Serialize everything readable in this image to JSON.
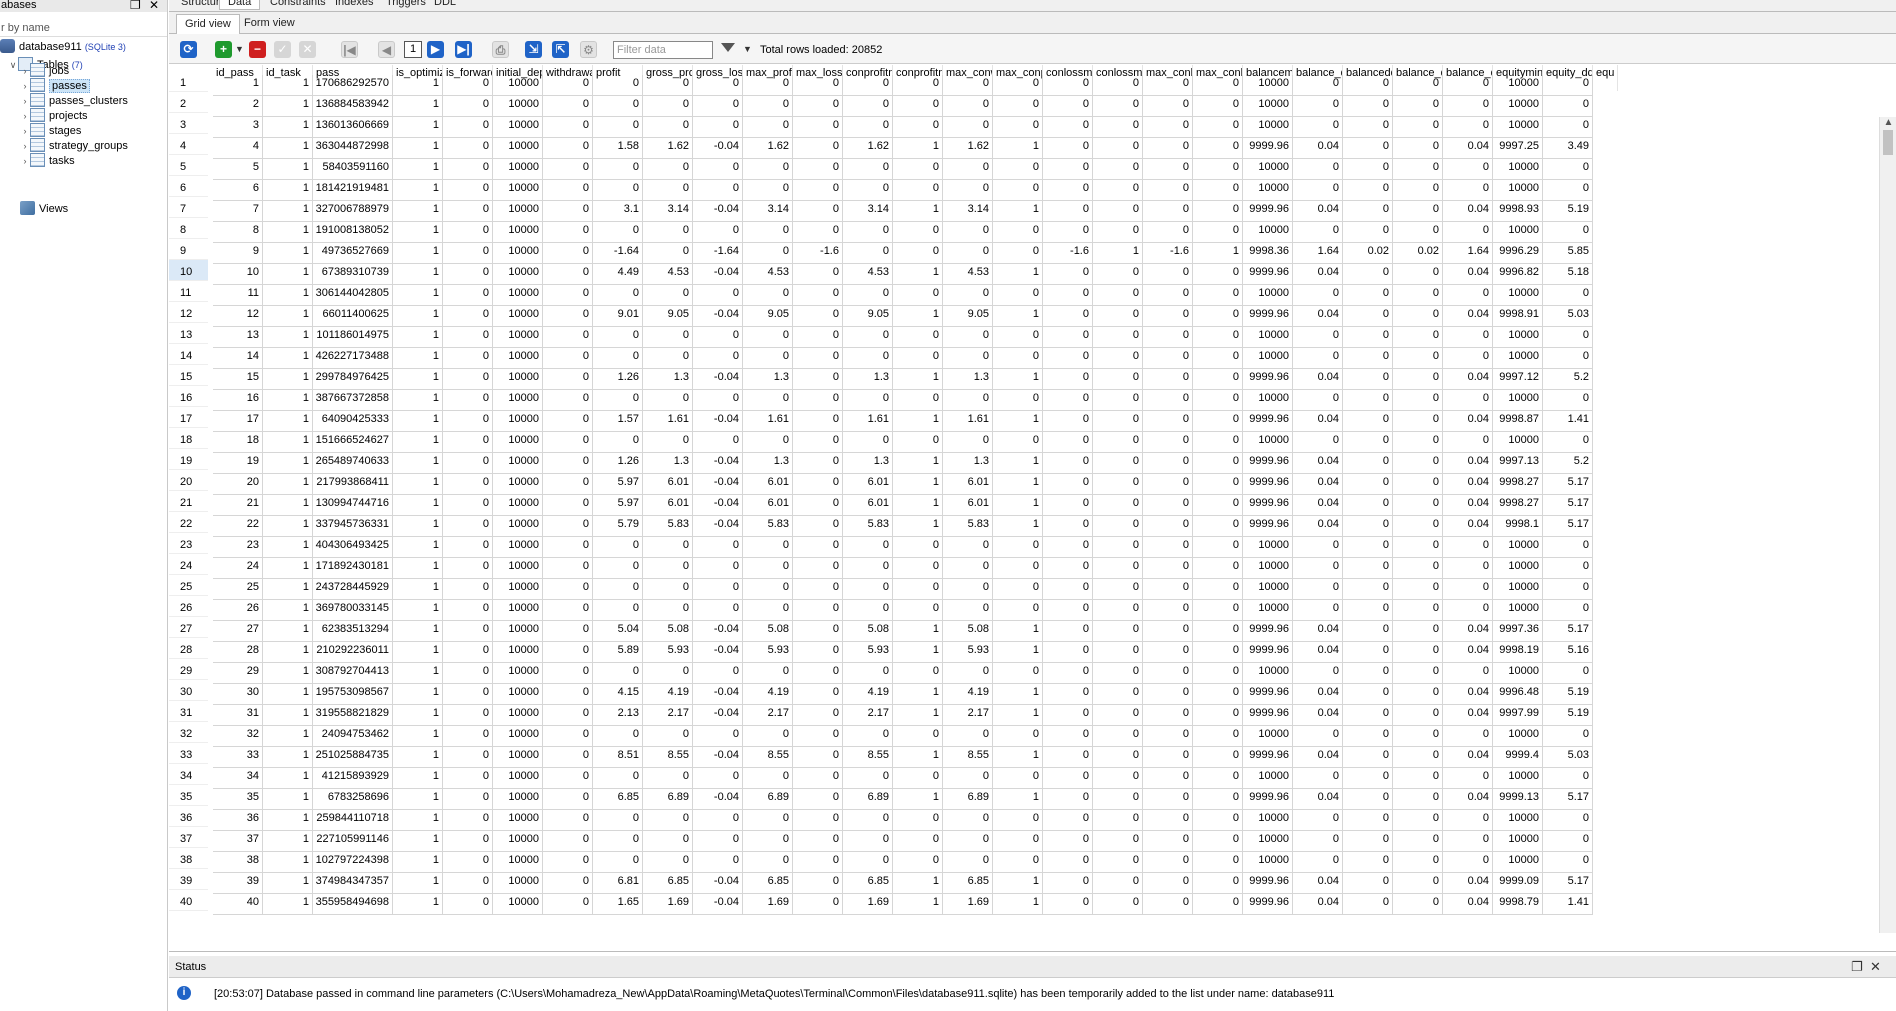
{
  "left_panel": {
    "title": "abases",
    "filter_placeholder": "r by name",
    "database": {
      "name": "database911",
      "type": "(SQLite 3)"
    },
    "tables": {
      "label": "Tables",
      "count": "(7)",
      "items": [
        "jobs",
        "passes",
        "passes_clusters",
        "projects",
        "stages",
        "strategy_groups",
        "tasks"
      ],
      "selected": "passes"
    },
    "views_label": "Views"
  },
  "top_tabs": [
    "Structure",
    "Data",
    "Constraints",
    "Indexes",
    "Triggers",
    "DDL"
  ],
  "active_top_tab": "Data",
  "sub_tabs": [
    "Grid view",
    "Form view"
  ],
  "active_sub_tab": "Grid view",
  "toolbar": {
    "page": "1",
    "filter_placeholder": "Filter data",
    "total_rows": "Total rows loaded: 20852"
  },
  "grid": {
    "columns": [
      "id_pass",
      "id_task",
      "pass",
      "is_optimiza",
      "is_forward",
      "initial_depc",
      "withdrawal",
      "profit",
      "gross_prof",
      "gross_loss",
      "max_profit",
      "max_lossti",
      "conprofitm",
      "conprofitm",
      "max_conwi",
      "max_conpr",
      "conlossmax",
      "conlossmax",
      "max_conlos",
      "max_conlos",
      "balancemin",
      "balance_dc",
      "balancedd_",
      "balance_dc",
      "balance_dc",
      "equitymin",
      "equity_dd",
      "equ"
    ],
    "current_row": 10,
    "rows": [
      [
        "1",
        "1",
        "170686292570",
        "1",
        "0",
        "10000",
        "0",
        "0",
        "0",
        "0",
        "0",
        "0",
        "0",
        "0",
        "0",
        "0",
        "0",
        "0",
        "0",
        "0",
        "10000",
        "0",
        "0",
        "0",
        "0",
        "10000",
        "0"
      ],
      [
        "2",
        "1",
        "136884583942",
        "1",
        "0",
        "10000",
        "0",
        "0",
        "0",
        "0",
        "0",
        "0",
        "0",
        "0",
        "0",
        "0",
        "0",
        "0",
        "0",
        "0",
        "10000",
        "0",
        "0",
        "0",
        "0",
        "10000",
        "0"
      ],
      [
        "3",
        "1",
        "136013606669",
        "1",
        "0",
        "10000",
        "0",
        "0",
        "0",
        "0",
        "0",
        "0",
        "0",
        "0",
        "0",
        "0",
        "0",
        "0",
        "0",
        "0",
        "10000",
        "0",
        "0",
        "0",
        "0",
        "10000",
        "0"
      ],
      [
        "4",
        "1",
        "363044872998",
        "1",
        "0",
        "10000",
        "0",
        "1.58",
        "1.62",
        "-0.04",
        "1.62",
        "0",
        "1.62",
        "1",
        "1.62",
        "1",
        "0",
        "0",
        "0",
        "0",
        "9999.96",
        "0.04",
        "0",
        "0",
        "0.04",
        "9997.25",
        "3.49"
      ],
      [
        "5",
        "1",
        "58403591160",
        "1",
        "0",
        "10000",
        "0",
        "0",
        "0",
        "0",
        "0",
        "0",
        "0",
        "0",
        "0",
        "0",
        "0",
        "0",
        "0",
        "0",
        "10000",
        "0",
        "0",
        "0",
        "0",
        "10000",
        "0"
      ],
      [
        "6",
        "1",
        "181421919481",
        "1",
        "0",
        "10000",
        "0",
        "0",
        "0",
        "0",
        "0",
        "0",
        "0",
        "0",
        "0",
        "0",
        "0",
        "0",
        "0",
        "0",
        "10000",
        "0",
        "0",
        "0",
        "0",
        "10000",
        "0"
      ],
      [
        "7",
        "1",
        "327006788979",
        "1",
        "0",
        "10000",
        "0",
        "3.1",
        "3.14",
        "-0.04",
        "3.14",
        "0",
        "3.14",
        "1",
        "3.14",
        "1",
        "0",
        "0",
        "0",
        "0",
        "9999.96",
        "0.04",
        "0",
        "0",
        "0.04",
        "9998.93",
        "5.19"
      ],
      [
        "8",
        "1",
        "191008138052",
        "1",
        "0",
        "10000",
        "0",
        "0",
        "0",
        "0",
        "0",
        "0",
        "0",
        "0",
        "0",
        "0",
        "0",
        "0",
        "0",
        "0",
        "10000",
        "0",
        "0",
        "0",
        "0",
        "10000",
        "0"
      ],
      [
        "9",
        "1",
        "49736527669",
        "1",
        "0",
        "10000",
        "0",
        "-1.64",
        "0",
        "-1.64",
        "0",
        "-1.6",
        "0",
        "0",
        "0",
        "0",
        "-1.6",
        "1",
        "-1.6",
        "1",
        "9998.36",
        "1.64",
        "0.02",
        "0.02",
        "1.64",
        "9996.29",
        "5.85"
      ],
      [
        "10",
        "1",
        "67389310739",
        "1",
        "0",
        "10000",
        "0",
        "4.49",
        "4.53",
        "-0.04",
        "4.53",
        "0",
        "4.53",
        "1",
        "4.53",
        "1",
        "0",
        "0",
        "0",
        "0",
        "9999.96",
        "0.04",
        "0",
        "0",
        "0.04",
        "9996.82",
        "5.18"
      ],
      [
        "11",
        "1",
        "306144042805",
        "1",
        "0",
        "10000",
        "0",
        "0",
        "0",
        "0",
        "0",
        "0",
        "0",
        "0",
        "0",
        "0",
        "0",
        "0",
        "0",
        "0",
        "10000",
        "0",
        "0",
        "0",
        "0",
        "10000",
        "0"
      ],
      [
        "12",
        "1",
        "66011400625",
        "1",
        "0",
        "10000",
        "0",
        "9.01",
        "9.05",
        "-0.04",
        "9.05",
        "0",
        "9.05",
        "1",
        "9.05",
        "1",
        "0",
        "0",
        "0",
        "0",
        "9999.96",
        "0.04",
        "0",
        "0",
        "0.04",
        "9998.91",
        "5.03"
      ],
      [
        "13",
        "1",
        "101186014975",
        "1",
        "0",
        "10000",
        "0",
        "0",
        "0",
        "0",
        "0",
        "0",
        "0",
        "0",
        "0",
        "0",
        "0",
        "0",
        "0",
        "0",
        "10000",
        "0",
        "0",
        "0",
        "0",
        "10000",
        "0"
      ],
      [
        "14",
        "1",
        "426227173488",
        "1",
        "0",
        "10000",
        "0",
        "0",
        "0",
        "0",
        "0",
        "0",
        "0",
        "0",
        "0",
        "0",
        "0",
        "0",
        "0",
        "0",
        "10000",
        "0",
        "0",
        "0",
        "0",
        "10000",
        "0"
      ],
      [
        "15",
        "1",
        "299784976425",
        "1",
        "0",
        "10000",
        "0",
        "1.26",
        "1.3",
        "-0.04",
        "1.3",
        "0",
        "1.3",
        "1",
        "1.3",
        "1",
        "0",
        "0",
        "0",
        "0",
        "9999.96",
        "0.04",
        "0",
        "0",
        "0.04",
        "9997.12",
        "5.2"
      ],
      [
        "16",
        "1",
        "387667372858",
        "1",
        "0",
        "10000",
        "0",
        "0",
        "0",
        "0",
        "0",
        "0",
        "0",
        "0",
        "0",
        "0",
        "0",
        "0",
        "0",
        "0",
        "10000",
        "0",
        "0",
        "0",
        "0",
        "10000",
        "0"
      ],
      [
        "17",
        "1",
        "64090425333",
        "1",
        "0",
        "10000",
        "0",
        "1.57",
        "1.61",
        "-0.04",
        "1.61",
        "0",
        "1.61",
        "1",
        "1.61",
        "1",
        "0",
        "0",
        "0",
        "0",
        "9999.96",
        "0.04",
        "0",
        "0",
        "0.04",
        "9998.87",
        "1.41"
      ],
      [
        "18",
        "1",
        "151666524627",
        "1",
        "0",
        "10000",
        "0",
        "0",
        "0",
        "0",
        "0",
        "0",
        "0",
        "0",
        "0",
        "0",
        "0",
        "0",
        "0",
        "0",
        "10000",
        "0",
        "0",
        "0",
        "0",
        "10000",
        "0"
      ],
      [
        "19",
        "1",
        "265489740633",
        "1",
        "0",
        "10000",
        "0",
        "1.26",
        "1.3",
        "-0.04",
        "1.3",
        "0",
        "1.3",
        "1",
        "1.3",
        "1",
        "0",
        "0",
        "0",
        "0",
        "9999.96",
        "0.04",
        "0",
        "0",
        "0.04",
        "9997.13",
        "5.2"
      ],
      [
        "20",
        "1",
        "217993868411",
        "1",
        "0",
        "10000",
        "0",
        "5.97",
        "6.01",
        "-0.04",
        "6.01",
        "0",
        "6.01",
        "1",
        "6.01",
        "1",
        "0",
        "0",
        "0",
        "0",
        "9999.96",
        "0.04",
        "0",
        "0",
        "0.04",
        "9998.27",
        "5.17"
      ],
      [
        "21",
        "1",
        "130994744716",
        "1",
        "0",
        "10000",
        "0",
        "5.97",
        "6.01",
        "-0.04",
        "6.01",
        "0",
        "6.01",
        "1",
        "6.01",
        "1",
        "0",
        "0",
        "0",
        "0",
        "9999.96",
        "0.04",
        "0",
        "0",
        "0.04",
        "9998.27",
        "5.17"
      ],
      [
        "22",
        "1",
        "337945736331",
        "1",
        "0",
        "10000",
        "0",
        "5.79",
        "5.83",
        "-0.04",
        "5.83",
        "0",
        "5.83",
        "1",
        "5.83",
        "1",
        "0",
        "0",
        "0",
        "0",
        "9999.96",
        "0.04",
        "0",
        "0",
        "0.04",
        "9998.1",
        "5.17"
      ],
      [
        "23",
        "1",
        "404306493425",
        "1",
        "0",
        "10000",
        "0",
        "0",
        "0",
        "0",
        "0",
        "0",
        "0",
        "0",
        "0",
        "0",
        "0",
        "0",
        "0",
        "0",
        "10000",
        "0",
        "0",
        "0",
        "0",
        "10000",
        "0"
      ],
      [
        "24",
        "1",
        "171892430181",
        "1",
        "0",
        "10000",
        "0",
        "0",
        "0",
        "0",
        "0",
        "0",
        "0",
        "0",
        "0",
        "0",
        "0",
        "0",
        "0",
        "0",
        "10000",
        "0",
        "0",
        "0",
        "0",
        "10000",
        "0"
      ],
      [
        "25",
        "1",
        "243728445929",
        "1",
        "0",
        "10000",
        "0",
        "0",
        "0",
        "0",
        "0",
        "0",
        "0",
        "0",
        "0",
        "0",
        "0",
        "0",
        "0",
        "0",
        "10000",
        "0",
        "0",
        "0",
        "0",
        "10000",
        "0"
      ],
      [
        "26",
        "1",
        "369780033145",
        "1",
        "0",
        "10000",
        "0",
        "0",
        "0",
        "0",
        "0",
        "0",
        "0",
        "0",
        "0",
        "0",
        "0",
        "0",
        "0",
        "0",
        "10000",
        "0",
        "0",
        "0",
        "0",
        "10000",
        "0"
      ],
      [
        "27",
        "1",
        "62383513294",
        "1",
        "0",
        "10000",
        "0",
        "5.04",
        "5.08",
        "-0.04",
        "5.08",
        "0",
        "5.08",
        "1",
        "5.08",
        "1",
        "0",
        "0",
        "0",
        "0",
        "9999.96",
        "0.04",
        "0",
        "0",
        "0.04",
        "9997.36",
        "5.17"
      ],
      [
        "28",
        "1",
        "210292236011",
        "1",
        "0",
        "10000",
        "0",
        "5.89",
        "5.93",
        "-0.04",
        "5.93",
        "0",
        "5.93",
        "1",
        "5.93",
        "1",
        "0",
        "0",
        "0",
        "0",
        "9999.96",
        "0.04",
        "0",
        "0",
        "0.04",
        "9998.19",
        "5.16"
      ],
      [
        "29",
        "1",
        "308792704413",
        "1",
        "0",
        "10000",
        "0",
        "0",
        "0",
        "0",
        "0",
        "0",
        "0",
        "0",
        "0",
        "0",
        "0",
        "0",
        "0",
        "0",
        "10000",
        "0",
        "0",
        "0",
        "0",
        "10000",
        "0"
      ],
      [
        "30",
        "1",
        "195753098567",
        "1",
        "0",
        "10000",
        "0",
        "4.15",
        "4.19",
        "-0.04",
        "4.19",
        "0",
        "4.19",
        "1",
        "4.19",
        "1",
        "0",
        "0",
        "0",
        "0",
        "9999.96",
        "0.04",
        "0",
        "0",
        "0.04",
        "9996.48",
        "5.19"
      ],
      [
        "31",
        "1",
        "319558821829",
        "1",
        "0",
        "10000",
        "0",
        "2.13",
        "2.17",
        "-0.04",
        "2.17",
        "0",
        "2.17",
        "1",
        "2.17",
        "1",
        "0",
        "0",
        "0",
        "0",
        "9999.96",
        "0.04",
        "0",
        "0",
        "0.04",
        "9997.99",
        "5.19"
      ],
      [
        "32",
        "1",
        "24094753462",
        "1",
        "0",
        "10000",
        "0",
        "0",
        "0",
        "0",
        "0",
        "0",
        "0",
        "0",
        "0",
        "0",
        "0",
        "0",
        "0",
        "0",
        "10000",
        "0",
        "0",
        "0",
        "0",
        "10000",
        "0"
      ],
      [
        "33",
        "1",
        "251025884735",
        "1",
        "0",
        "10000",
        "0",
        "8.51",
        "8.55",
        "-0.04",
        "8.55",
        "0",
        "8.55",
        "1",
        "8.55",
        "1",
        "0",
        "0",
        "0",
        "0",
        "9999.96",
        "0.04",
        "0",
        "0",
        "0.04",
        "9999.4",
        "5.03"
      ],
      [
        "34",
        "1",
        "41215893929",
        "1",
        "0",
        "10000",
        "0",
        "0",
        "0",
        "0",
        "0",
        "0",
        "0",
        "0",
        "0",
        "0",
        "0",
        "0",
        "0",
        "0",
        "10000",
        "0",
        "0",
        "0",
        "0",
        "10000",
        "0"
      ],
      [
        "35",
        "1",
        "6783258696",
        "1",
        "0",
        "10000",
        "0",
        "6.85",
        "6.89",
        "-0.04",
        "6.89",
        "0",
        "6.89",
        "1",
        "6.89",
        "1",
        "0",
        "0",
        "0",
        "0",
        "9999.96",
        "0.04",
        "0",
        "0",
        "0.04",
        "9999.13",
        "5.17"
      ],
      [
        "36",
        "1",
        "259844110718",
        "1",
        "0",
        "10000",
        "0",
        "0",
        "0",
        "0",
        "0",
        "0",
        "0",
        "0",
        "0",
        "0",
        "0",
        "0",
        "0",
        "0",
        "10000",
        "0",
        "0",
        "0",
        "0",
        "10000",
        "0"
      ],
      [
        "37",
        "1",
        "227105991146",
        "1",
        "0",
        "10000",
        "0",
        "0",
        "0",
        "0",
        "0",
        "0",
        "0",
        "0",
        "0",
        "0",
        "0",
        "0",
        "0",
        "0",
        "10000",
        "0",
        "0",
        "0",
        "0",
        "10000",
        "0"
      ],
      [
        "38",
        "1",
        "102797224398",
        "1",
        "0",
        "10000",
        "0",
        "0",
        "0",
        "0",
        "0",
        "0",
        "0",
        "0",
        "0",
        "0",
        "0",
        "0",
        "0",
        "0",
        "10000",
        "0",
        "0",
        "0",
        "0",
        "10000",
        "0"
      ],
      [
        "39",
        "1",
        "374984347357",
        "1",
        "0",
        "10000",
        "0",
        "6.81",
        "6.85",
        "-0.04",
        "6.85",
        "0",
        "6.85",
        "1",
        "6.85",
        "1",
        "0",
        "0",
        "0",
        "0",
        "9999.96",
        "0.04",
        "0",
        "0",
        "0.04",
        "9999.09",
        "5.17"
      ],
      [
        "40",
        "1",
        "355958494698",
        "1",
        "0",
        "10000",
        "0",
        "1.65",
        "1.69",
        "-0.04",
        "1.69",
        "0",
        "1.69",
        "1",
        "1.69",
        "1",
        "0",
        "0",
        "0",
        "0",
        "9999.96",
        "0.04",
        "0",
        "0",
        "0.04",
        "9998.79",
        "1.41"
      ]
    ]
  },
  "status_panel": {
    "title": "Status",
    "message": "[20:53:07]  Database passed in command line parameters (C:\\Users\\Mohamadreza_New\\AppData\\Roaming\\MetaQuotes\\Terminal\\Common\\Files\\database911.sqlite) has been temporarily added to the list under name: database911"
  },
  "icons": {
    "refresh": "refresh-icon",
    "add": "add-row-icon",
    "delete": "delete-row-icon",
    "commit": "commit-icon",
    "rollback": "rollback-icon",
    "info": "info-icon"
  }
}
